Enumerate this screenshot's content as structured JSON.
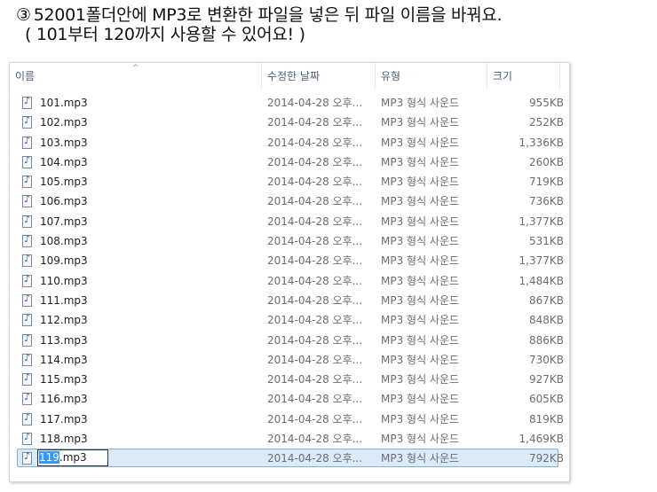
{
  "instructions": {
    "marker": "③",
    "line1": "52001폴더안에 MP3로 변환한 파일을 넣은 뒤 파일 이름을 바꿔요.",
    "line2": "( 101부터 120까지 사용할 수 있어요! )"
  },
  "explorer": {
    "columns": {
      "name": "이름",
      "date": "수정한 날짜",
      "type": "유형",
      "size": "크기"
    },
    "sort_indicator": "^",
    "files": [
      {
        "name": "101.mp3",
        "date": "2014-04-28 오후...",
        "type": "MP3 형식 사운드",
        "size": "955KB"
      },
      {
        "name": "102.mp3",
        "date": "2014-04-28 오후...",
        "type": "MP3 형식 사운드",
        "size": "252KB"
      },
      {
        "name": "103.mp3",
        "date": "2014-04-28 오후...",
        "type": "MP3 형식 사운드",
        "size": "1,336KB"
      },
      {
        "name": "104.mp3",
        "date": "2014-04-28 오후...",
        "type": "MP3 형식 사운드",
        "size": "260KB"
      },
      {
        "name": "105.mp3",
        "date": "2014-04-28 오후...",
        "type": "MP3 형식 사운드",
        "size": "719KB"
      },
      {
        "name": "106.mp3",
        "date": "2014-04-28 오후...",
        "type": "MP3 형식 사운드",
        "size": "736KB"
      },
      {
        "name": "107.mp3",
        "date": "2014-04-28 오후...",
        "type": "MP3 형식 사운드",
        "size": "1,377KB"
      },
      {
        "name": "108.mp3",
        "date": "2014-04-28 오후...",
        "type": "MP3 형식 사운드",
        "size": "531KB"
      },
      {
        "name": "109.mp3",
        "date": "2014-04-28 오후...",
        "type": "MP3 형식 사운드",
        "size": "1,377KB"
      },
      {
        "name": "110.mp3",
        "date": "2014-04-28 오후...",
        "type": "MP3 형식 사운드",
        "size": "1,484KB"
      },
      {
        "name": "111.mp3",
        "date": "2014-04-28 오후...",
        "type": "MP3 형식 사운드",
        "size": "867KB"
      },
      {
        "name": "112.mp3",
        "date": "2014-04-28 오후...",
        "type": "MP3 형식 사운드",
        "size": "848KB"
      },
      {
        "name": "113.mp3",
        "date": "2014-04-28 오후...",
        "type": "MP3 형식 사운드",
        "size": "886KB"
      },
      {
        "name": "114.mp3",
        "date": "2014-04-28 오후...",
        "type": "MP3 형식 사운드",
        "size": "730KB"
      },
      {
        "name": "115.mp3",
        "date": "2014-04-28 오후...",
        "type": "MP3 형식 사운드",
        "size": "927KB"
      },
      {
        "name": "116.mp3",
        "date": "2014-04-28 오후...",
        "type": "MP3 형식 사운드",
        "size": "605KB"
      },
      {
        "name": "117.mp3",
        "date": "2014-04-28 오후...",
        "type": "MP3 형식 사운드",
        "size": "819KB"
      },
      {
        "name": "118.mp3",
        "date": "2014-04-28 오후...",
        "type": "MP3 형식 사운드",
        "size": "1,469KB"
      }
    ],
    "renaming_file": {
      "selected_text": "119",
      "rest_text": ".mp3",
      "date": "2014-04-28 오후...",
      "type": "MP3 형식 사운드",
      "size": "792KB"
    },
    "icon": "mp3-file-icon"
  }
}
